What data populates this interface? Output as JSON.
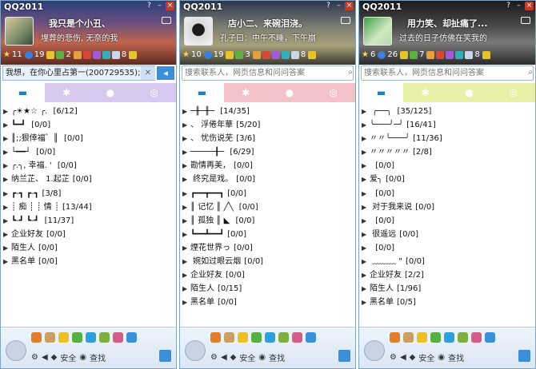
{
  "panels": [
    {
      "title": "QQ2011",
      "nickname": "我只是个小丑、",
      "signature": "埋葬的悲伤,         无奈的我",
      "search_value": "我想，在你心里占第一(200729535);",
      "search_placeholder": "",
      "counts": [
        "11",
        "19",
        "2",
        "8"
      ],
      "groups": [
        {
          "label": "╭☀★☆  ╭. ",
          "count": "[6/12]"
        },
        {
          "label": "┗━┛ ",
          "count": "[0/0]"
        },
        {
          "label": "║;;狠倖福゛║ ",
          "count": "[0/0]"
        },
        {
          "label": "└━━┘ ",
          "count": "[0/0]"
        },
        {
          "label": "╭.╮, 幸福. ' ",
          "count": "[0/0]"
        },
        {
          "label": "纳兰芷、 1.起芷",
          "count": "[0/0]"
        },
        {
          "label": "┏-┓  ┏-┓",
          "count": "[3/8]"
        },
        {
          "label": "┊ 痴 ┊   ┊ 情 ┊",
          "count": "[13/44]"
        },
        {
          "label": "┗-┛   ┗-┛ ",
          "count": "[11/37]"
        },
        {
          "label": "企业好友",
          "count": "[0/0]"
        },
        {
          "label": "陌生人",
          "count": "[0/0]"
        },
        {
          "label": "黑名单",
          "count": "[0/0]"
        }
      ]
    },
    {
      "title": "QQ2011",
      "nickname": "店小二、来碗泪浇。",
      "signature": "孔子曰：中午不睡，下午崩",
      "search_value": "",
      "search_placeholder": "搜索联系人，网页信息和问问答案",
      "counts": [
        "10",
        "19",
        "3",
        "8"
      ],
      "groups": [
        {
          "label": "─╫─╫─ ",
          "count": "[14/35]"
        },
        {
          "label": "、 浮倦年華",
          "count": "[5/20]"
        },
        {
          "label": "、 忧伤说芜",
          "count": "[3/6]"
        },
        {
          "label": "─────╂─  ",
          "count": "[6/29]"
        },
        {
          "label": "勘情再美，",
          "count": "[0/0]"
        },
        {
          "label": "   终究是戏。",
          "count": "[0/0]"
        },
        {
          "label": "┏━━┳━━┓",
          "count": "[0/0]"
        },
        {
          "label": "║ 记忆 ║ ╱╲ ",
          "count": "[0/0]"
        },
        {
          "label": "║ 孤独 ║ ◣ ",
          "count": "[0/0]"
        },
        {
          "label": "┗━━┻━━┛",
          "count": "[0/0]"
        },
        {
          "label": "煙花世界っ",
          "count": "[0/0]"
        },
        {
          "label": "   婉如过眼云烟",
          "count": "[0/0]"
        },
        {
          "label": "企业好友",
          "count": "[0/0]"
        },
        {
          "label": "陌生人",
          "count": "[0/15]"
        },
        {
          "label": "黑名单",
          "count": "[0/0]"
        }
      ]
    },
    {
      "title": "QQ2011",
      "nickname": "用力笑、却扯痛了...",
      "signature": "过去的日子仿佛在笑我的",
      "search_value": "",
      "search_placeholder": "搜索联系人，网页信息和问问答案",
      "counts": [
        "6",
        "26",
        "7",
        "8"
      ],
      "groups": [
        {
          "label": "  ╭──╮  ",
          "count": "[35/125]"
        },
        {
          "label": "╰───╯─╯",
          "count": "[16/41]"
        },
        {
          "label": "〃〃╰───╯",
          "count": "[11/36]"
        },
        {
          "label": "〃〃〃〃〃",
          "count": "[2/8]"
        },
        {
          "label": "          ",
          "count": "[0/0]"
        },
        {
          "label": "爱╮",
          "count": "[0/0]"
        },
        {
          "label": "          ",
          "count": "[0/0]"
        },
        {
          "label": "      对于我来说",
          "count": "[0/0]"
        },
        {
          "label": "          ",
          "count": "[0/0]"
        },
        {
          "label": "          很遥远",
          "count": "[0/0]"
        },
        {
          "label": "          ",
          "count": "[0/0]"
        },
        {
          "label": "        ﹏﹏﹏ \"",
          "count": "[0/0]"
        },
        {
          "label": "企业好友",
          "count": "[2/2]"
        },
        {
          "label": "陌生人",
          "count": "[1/96]"
        },
        {
          "label": "黑名单",
          "count": "[0/5]"
        }
      ]
    }
  ],
  "bottom": {
    "safety_label": "安全",
    "find_label": "查找"
  }
}
